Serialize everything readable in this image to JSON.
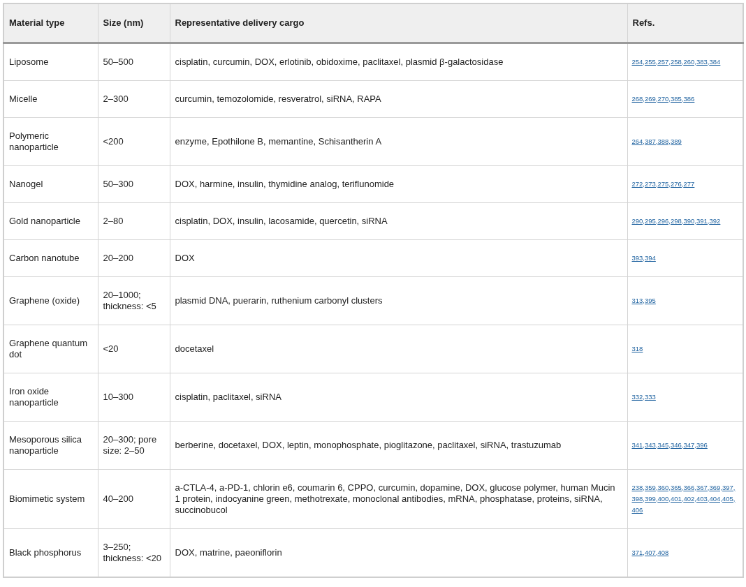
{
  "table": {
    "columns": [
      "Material type",
      "Size (nm)",
      "Representative delivery cargo",
      "Refs."
    ],
    "rows": [
      {
        "material": "Liposome",
        "size": "50–500",
        "cargo": "cisplatin, curcumin, DOX, erlotinib, obidoxime, paclitaxel, plasmid β-galactosidase",
        "refs": [
          "254,",
          "255,",
          "257,",
          "258,",
          "260,",
          "383,",
          "384"
        ]
      },
      {
        "material": "Micelle",
        "size": "2–300",
        "cargo": "curcumin, temozolomide, resveratrol, siRNA, RAPA",
        "refs": [
          "268,",
          "269,",
          "270,",
          "385,",
          "386"
        ]
      },
      {
        "material": "Polymeric nanoparticle",
        "size": "<200",
        "cargo": "enzyme, Epothilone B, memantine, Schisantherin A",
        "refs": [
          "264,",
          "387,",
          "388,",
          "389"
        ]
      },
      {
        "material": "Nanogel",
        "size": "50–300",
        "cargo": "DOX, harmine, insulin, thymidine analog, teriflunomide",
        "refs": [
          "272,",
          "273,",
          "275,",
          "276,",
          "277"
        ]
      },
      {
        "material": "Gold nanoparticle",
        "size": "2–80",
        "cargo": "cisplatin, DOX, insulin, lacosamide, quercetin, siRNA",
        "refs": [
          "290,",
          "295,",
          "296,",
          "298,",
          "390,",
          "391,",
          "392"
        ]
      },
      {
        "material": "Carbon nanotube",
        "size": "20–200",
        "cargo": "DOX",
        "refs": [
          "393,",
          "394"
        ]
      },
      {
        "material": "Graphene (oxide)",
        "size": "20–1000; thickness: <5",
        "cargo": "plasmid DNA, puerarin, ruthenium carbonyl clusters",
        "refs": [
          "313,",
          "395"
        ]
      },
      {
        "material": "Graphene quantum dot",
        "size": "<20",
        "cargo": "docetaxel",
        "refs": [
          "318"
        ]
      },
      {
        "material": "Iron oxide nanoparticle",
        "size": "10–300",
        "cargo": "cisplatin, paclitaxel, siRNA",
        "refs": [
          "332,",
          "333"
        ]
      },
      {
        "material": "Mesoporous silica nanoparticle",
        "size": "20–300; pore size: 2–50",
        "cargo": "berberine, docetaxel, DOX, leptin, monophosphate, pioglitazone, paclitaxel, siRNA, trastuzumab",
        "refs": [
          "341,",
          "343,",
          "345,",
          "346,",
          "347,",
          "396"
        ]
      },
      {
        "material": "Biomimetic system",
        "size": "40–200",
        "cargo": "a-CTLA-4, a-PD-1, chlorin e6, coumarin 6, CPPO, curcumin, dopamine, DOX, glucose polymer, human Mucin 1 protein, indocyanine green, methotrexate, monoclonal antibodies, mRNA, phosphatase, proteins, siRNA, succinobucol",
        "refs": [
          "238,",
          "359,",
          "360,",
          "365,",
          "366,",
          "367,",
          "369,",
          "397,",
          "398,",
          "399,",
          "400,",
          "401,",
          "402,",
          "403,",
          "404,",
          "405,",
          "406"
        ]
      },
      {
        "material": "Black phosphorus",
        "size": "3–250; thickness: <20",
        "cargo": "DOX, matrine, paeoniflorin",
        "refs": [
          "371,",
          "407,",
          "408"
        ]
      }
    ]
  }
}
